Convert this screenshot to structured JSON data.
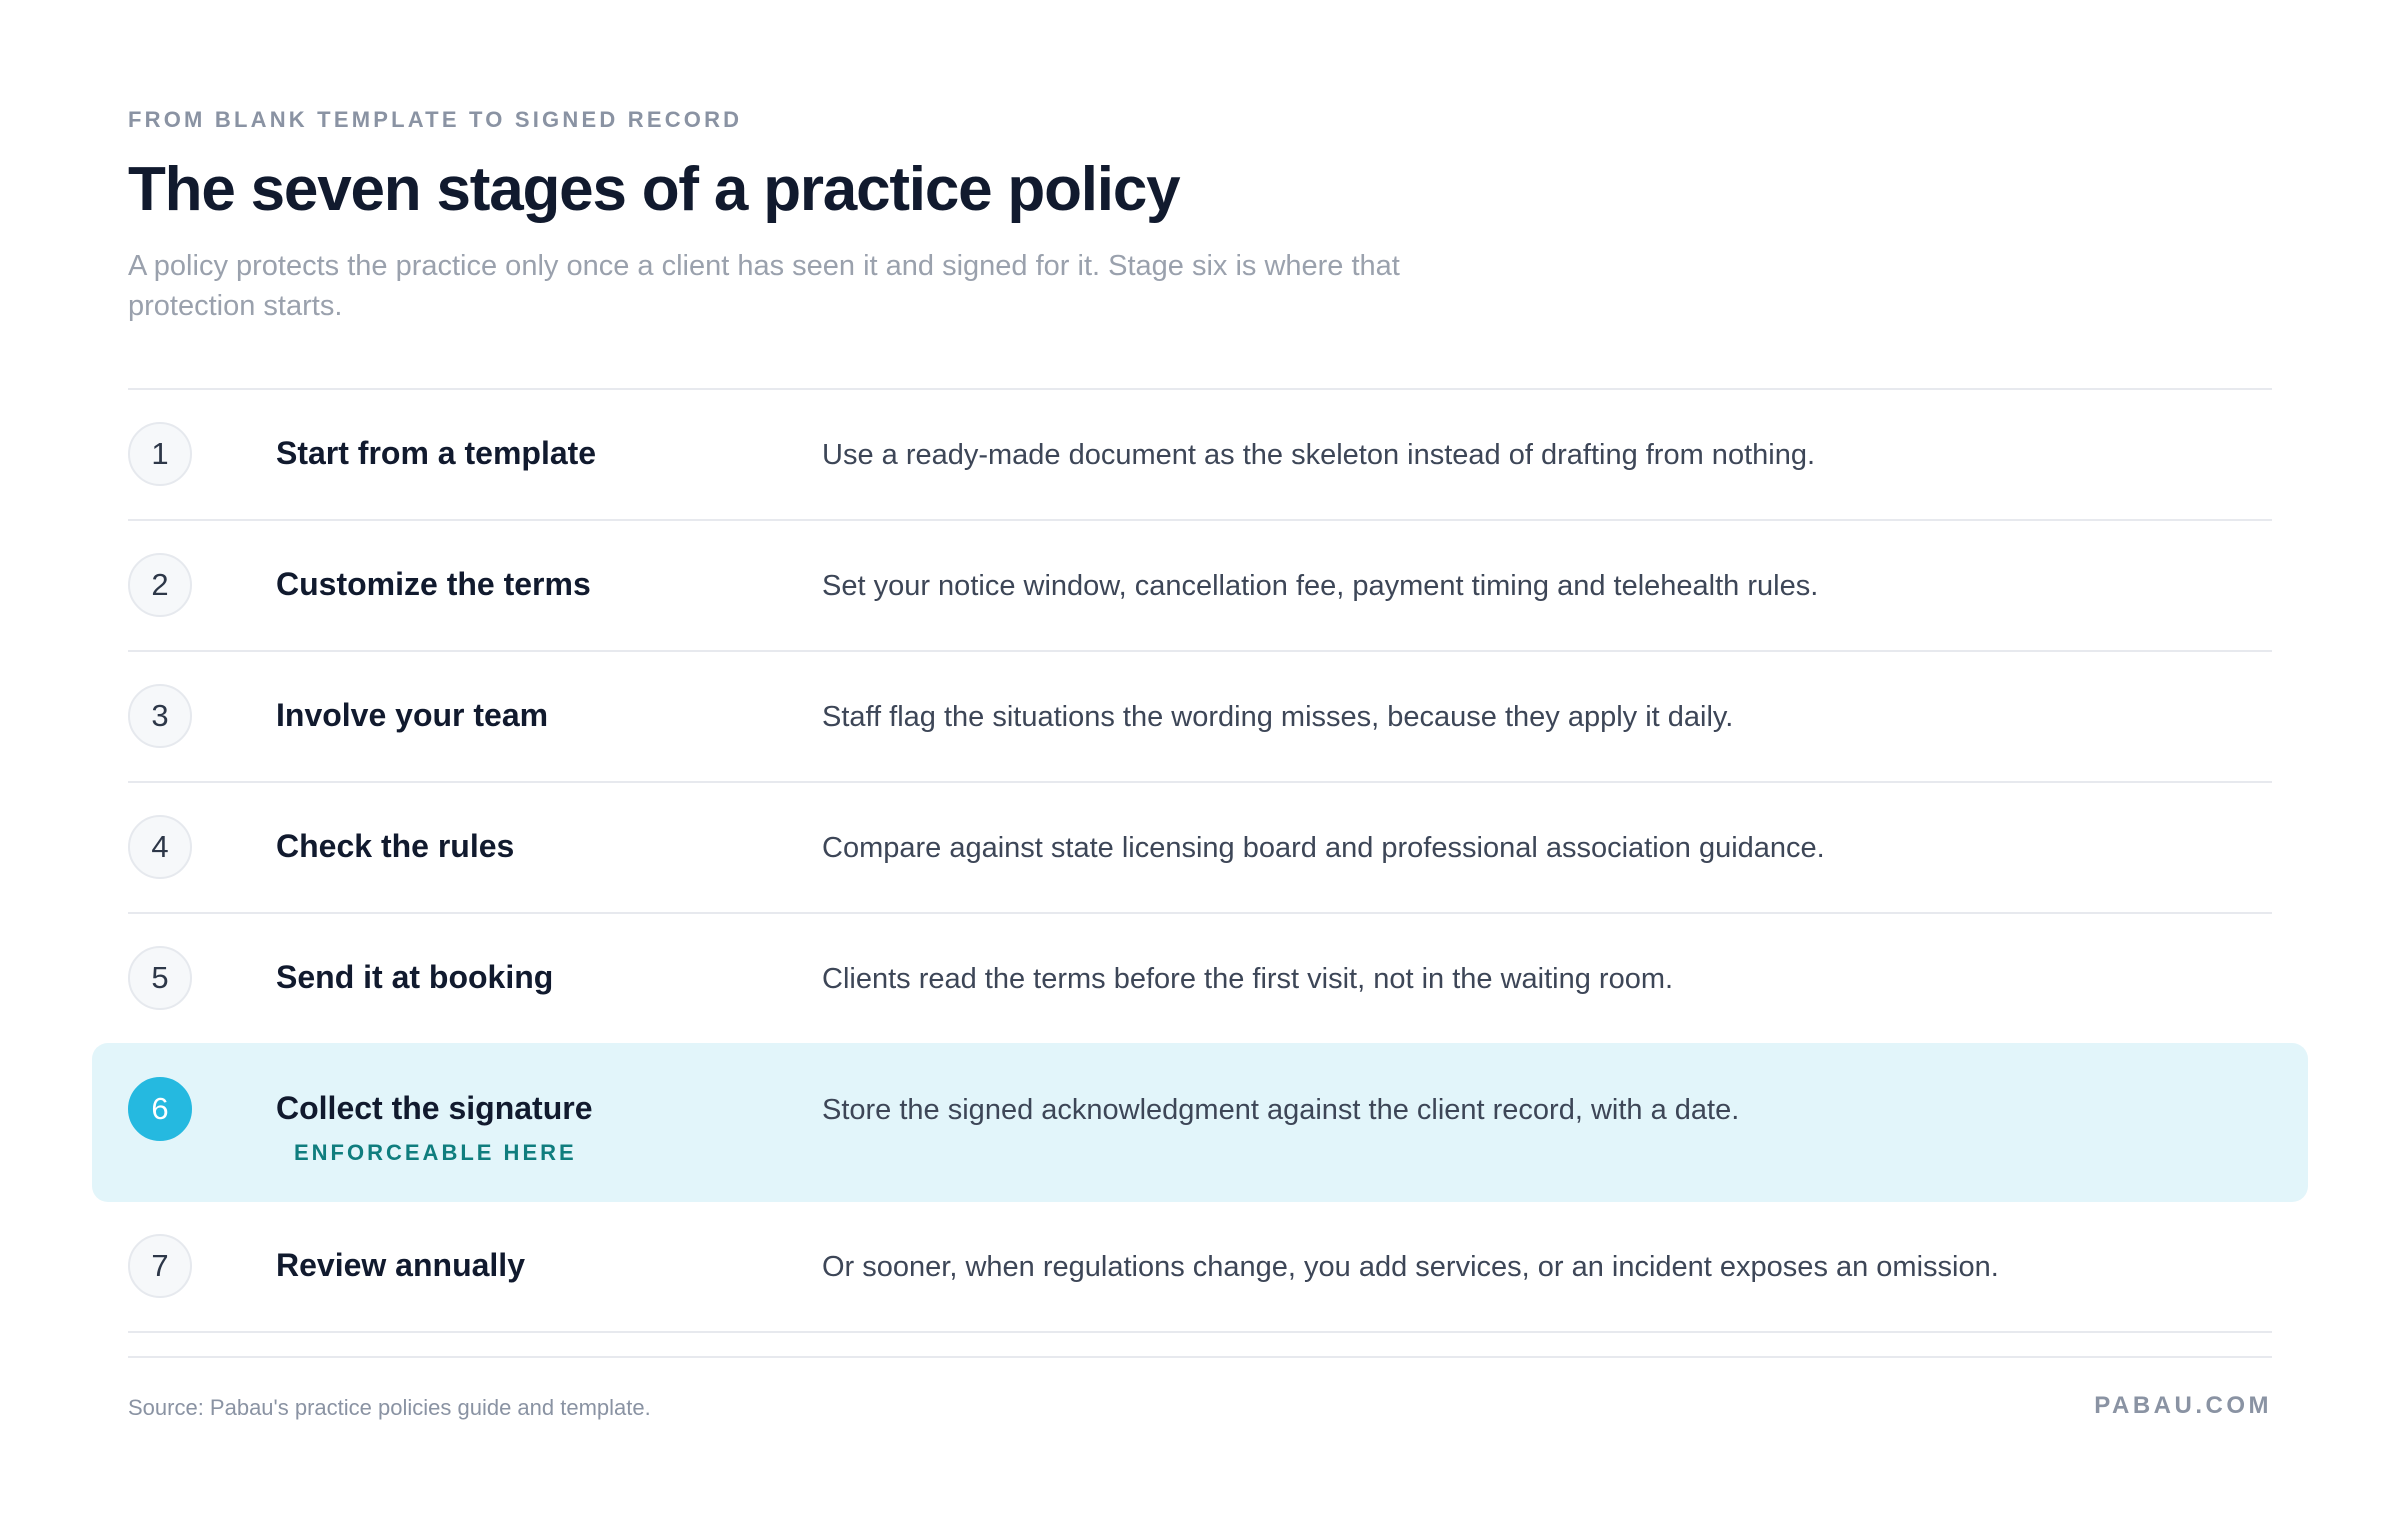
{
  "header": {
    "eyebrow": "FROM BLANK TEMPLATE TO SIGNED RECORD",
    "title": "The seven stages of a practice policy",
    "subtitle": "A policy protects the practice only once a client has seen it and signed for it. Stage six is where that protection starts."
  },
  "steps": [
    {
      "number": "1",
      "name": "Start from a template",
      "description": "Use a ready-made document as the skeleton instead of drafting from nothing."
    },
    {
      "number": "2",
      "name": "Customize the terms",
      "description": "Set your notice window, cancellation fee, payment timing and telehealth rules."
    },
    {
      "number": "3",
      "name": "Involve your team",
      "description": "Staff flag the situations the wording misses, because they apply it daily."
    },
    {
      "number": "4",
      "name": "Check the rules",
      "description": "Compare against state licensing board and professional association guidance."
    },
    {
      "number": "5",
      "name": "Send it at booking",
      "description": "Clients read the terms before the first visit, not in the waiting room."
    },
    {
      "number": "6",
      "name": "Collect the signature",
      "tag": "ENFORCEABLE HERE",
      "description": "Store the signed acknowledgment against the client record, with a date."
    },
    {
      "number": "7",
      "name": "Review annually",
      "description": "Or sooner, when regulations change, you add services, or an incident exposes an omission."
    }
  ],
  "highlighted_step": 6,
  "colors": {
    "accent": "#25b9e0",
    "highlight_background": "#e2f5fa",
    "tag_text": "#0f7d7e"
  },
  "footer": {
    "source": "Source: Pabau's practice policies guide and template.",
    "brand": "PABAU.COM"
  }
}
